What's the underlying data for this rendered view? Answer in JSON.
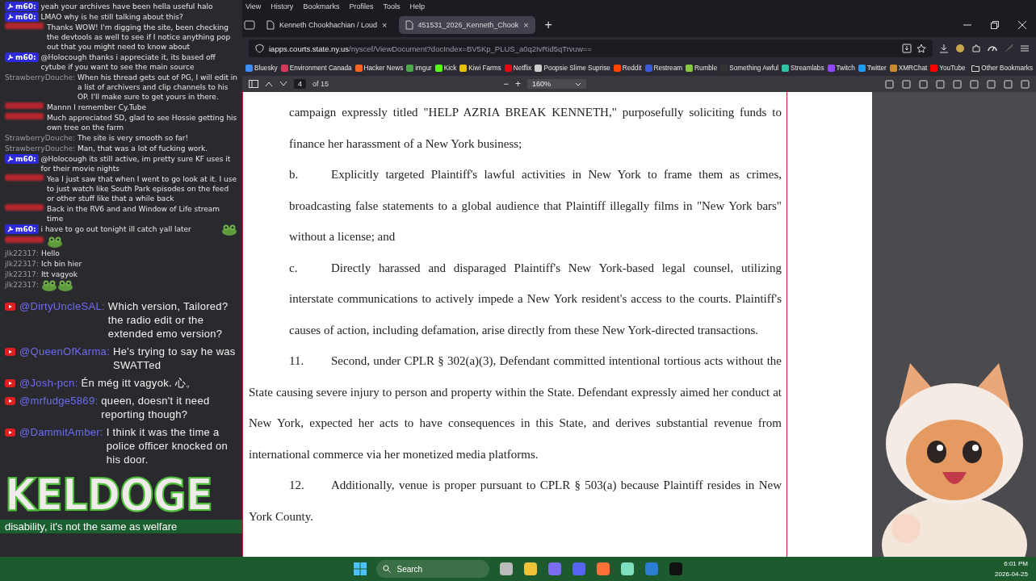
{
  "menu": [
    "View",
    "History",
    "Bookmarks",
    "Profiles",
    "Tools",
    "Help"
  ],
  "tabs": [
    {
      "title": "Kenneth Chookhachian / Loud",
      "close": "×",
      "selected": false
    },
    {
      "title": "451531_2026_Kenneth_Chook",
      "close": "×",
      "selected": true
    }
  ],
  "new_tab": "+",
  "address": {
    "host": "iapps.courts.state.ny.us",
    "path": "/nyscef/ViewDocument?docIndex=BV5Kp_PLUS_a0q2IvRid5qTrvuw=="
  },
  "bookmarks": [
    "Bluesky",
    "Environment Canada",
    "Hacker News",
    "imgur",
    "Kick",
    "Kiwi Farms",
    "Netflix",
    "Poopsie Slime Suprise",
    "Reddit",
    "Restream",
    "Rumble",
    "Something Awful",
    "Streamlabs",
    "Twitch",
    "Twitter",
    "XMRChat",
    "YouTube"
  ],
  "other_bookmarks": "Other Bookmarks",
  "pdf_toolbar": {
    "page": "4",
    "page_count": "of 15",
    "zoom_out": "−",
    "zoom_in": "+",
    "zoom": "160%"
  },
  "document": [
    {
      "kind": "continuation",
      "text": "campaign expressly titled \"HELP AZRIA BREAK KENNETH,\" purposefully soliciting funds to finance her harassment of a New York business;"
    },
    {
      "kind": "subitem",
      "label": "b.",
      "text": "Explicitly targeted Plaintiff's lawful activities in New York to frame them as crimes, broadcasting false statements to a global audience that Plaintiff illegally films in \"New York bars\" without a license; and"
    },
    {
      "kind": "subitem",
      "label": "c.",
      "text": "Directly harassed and disparaged Plaintiff's New York-based legal counsel, utilizing interstate communications to actively impede a New York resident's access to the courts.  Plaintiff's causes of action, including defamation, arise directly from these New York-directed transactions."
    },
    {
      "kind": "numbered",
      "label": "11.",
      "text": "Second, under CPLR § 302(a)(3), Defendant committed intentional tortious acts without the State causing severe injury to person and property within the State.  Defendant expressly aimed her conduct at New York, expected her acts to have consequences in this State, and derives substantial revenue from international commerce via her monetized media platforms."
    },
    {
      "kind": "numbered",
      "label": "12.",
      "text": "Additionally, venue is proper pursuant to CPLR § 503(a) because Plaintiff resides in New York County."
    }
  ],
  "site_chat": [
    {
      "kind": "badge",
      "author": "m60:",
      "text": "yeah your archives have been hella useful halo"
    },
    {
      "kind": "badge",
      "author": "m60:",
      "text": "LMAO why is he still talking about this?"
    },
    {
      "kind": "redacted",
      "text": "Thanks WOW! I'm digging the site, been checking the devtools as well to see if I notice anything pop out that you might need to know about"
    },
    {
      "kind": "badge",
      "author": "m60:",
      "text": "@Holocough thanks i appreciate it, its based off cytube if you want to see the main source"
    },
    {
      "kind": "plain",
      "author": "StrawberryDouche:",
      "text": "When his thread gets out of PG, I will edit in a list of archivers and clip channels to his OP. I'll make sure to get yours in there."
    },
    {
      "kind": "redacted",
      "text": "Mannn I remember Cy.Tube"
    },
    {
      "kind": "redacted",
      "text": "Much appreciated SD, glad to see Hossie getting his own tree on the farm"
    },
    {
      "kind": "plain",
      "author": "StrawberryDouche:",
      "text": "The site is very smooth so far!"
    },
    {
      "kind": "plain",
      "author": "StrawberryDouche:",
      "text": "Man, that was a lot of fucking work."
    },
    {
      "kind": "badge",
      "author": "m60:",
      "text": "@Holocough its still active, im pretty sure KF uses it for their movie nights"
    },
    {
      "kind": "redacted",
      "text": "Yea I just saw that when I went to go look at it.  I use to just watch like South Park episodes on the feed or other stuff like that a while back"
    },
    {
      "kind": "redacted",
      "text": "Back in the RV6 and and Window of Life stream time"
    },
    {
      "kind": "badge",
      "author": "m60:",
      "text": "i have to go out tonight ill catch yall later",
      "emoji": [
        {
          "kind": "frog"
        }
      ]
    },
    {
      "kind": "redacted",
      "emoji": [
        {
          "kind": "frog"
        }
      ]
    },
    {
      "kind": "plain",
      "author": "jlk22317:",
      "text": "Hello"
    },
    {
      "kind": "plain",
      "author": "jlk22317:",
      "text": "Ich bin hier"
    },
    {
      "kind": "plain",
      "author": "jlk22317:",
      "text": "Itt vagyok"
    },
    {
      "kind": "plain",
      "author": "jlk22317:",
      "emoji": [
        {
          "kind": "frog"
        },
        {
          "kind": "frog"
        }
      ]
    }
  ],
  "youtube_chat": [
    {
      "author": "@DirtyUncleSAL:",
      "text": "Which version, Tailored? the radio edit or the extended emo version?"
    },
    {
      "author": "@QueenOfKarma:",
      "text": "He's trying to say he was SWATTed"
    },
    {
      "author": "@Josh-pcn:",
      "text": "Én még itt vagyok. 心。"
    },
    {
      "author": "@mrfudge5869:",
      "text": "queen, doesn't it need reporting though?"
    },
    {
      "author": "@DammitAmber:",
      "text": "I think it was the time a police officer knocked on his door."
    }
  ],
  "logo": "KELDOGE",
  "last_chat_line": "disability, it's not the same as welfare",
  "taskbar": {
    "search": "Search",
    "time": "6:01 PM",
    "date": "2026-04-25"
  }
}
